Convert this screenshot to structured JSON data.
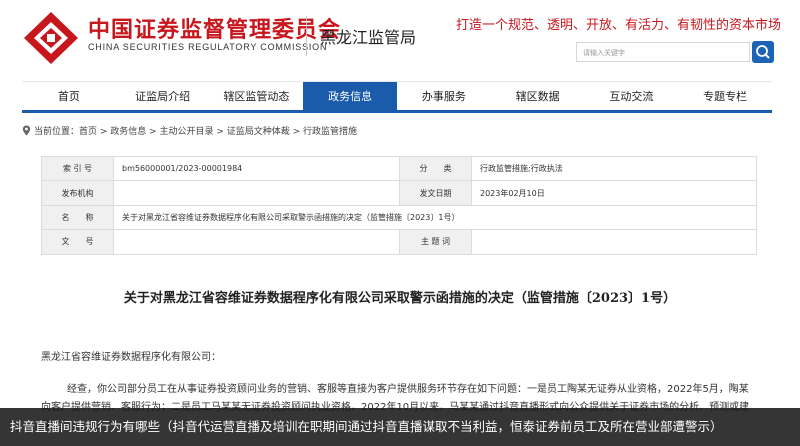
{
  "header": {
    "logo_cn": "中国证券监督管理委员会",
    "logo_en": "CHINA SECURITIES REGULATORY COMMISSION",
    "branch": "黑龙江监管局",
    "slogan": "打造一个规范、透明、开放、有活力、有韧性的资本市场",
    "search_placeholder": "请输入关键字",
    "brand_color": "#c8161d",
    "accent_color": "#1a5cab"
  },
  "nav": {
    "items": [
      "首页",
      "证监局介绍",
      "辖区监管动态",
      "政务信息",
      "办事服务",
      "辖区数据",
      "互动交流",
      "专题专栏"
    ],
    "active_index": 3
  },
  "breadcrumb": {
    "text": "当前位置：首页 > 政务信息 > 主动公开目录 > 证监局文种体裁 > 行政监管措施"
  },
  "meta": {
    "index_label": "索 引 号",
    "index_value": "bm56000001/2023-00001984",
    "category_label": "分　　类",
    "category_value": "行政监管措施;行政执法",
    "issuer_label": "发布机构",
    "issuer_value": "",
    "date_label": "发文日期",
    "date_value": "2023年02月10日",
    "name_label": "名　　称",
    "name_value": "关于对黑龙江省容维证券数据程序化有限公司采取警示函措施的决定（监管措施〔2023〕1号）",
    "docno_label": "文　　号",
    "docno_value": "",
    "subject_label": "主 题 词",
    "subject_value": ""
  },
  "document": {
    "title": "关于对黑龙江省容维证券数据程序化有限公司采取警示函措施的决定（监管措施〔2023〕1号）",
    "addressee": "黑龙江省容维证券数据程序化有限公司：",
    "body": "经查，你公司部分员工在从事证券投资顾问业务的营销、客服等直接为客户提供服务环节存在如下问题：一是员工陶某无证券从业资格，2022年5月，陶某向客户提供营销、客服行为；二是员工马某某无证券投资顾问执业资格，2022年10月以来，马某某通过抖音直播形式向公众提供关于证券市场的分析、预测或建议"
  },
  "caption": {
    "text": "抖音直播间违规行为有哪些（抖音代运营直播及培训在职期间通过抖音直播谋取不当利益，恒泰证券前员工及所在营业部遭警示）"
  }
}
